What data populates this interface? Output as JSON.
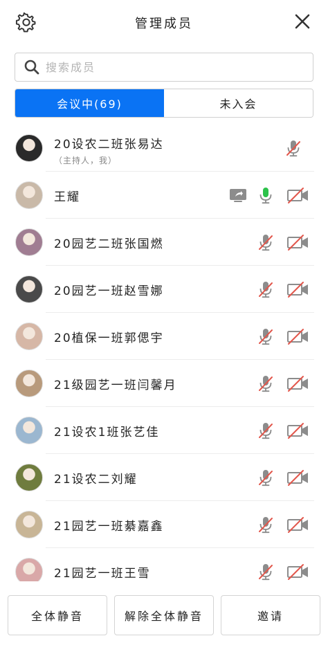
{
  "header": {
    "title": "管理成员"
  },
  "search": {
    "placeholder": "搜索成员"
  },
  "tabs": [
    {
      "label": "会议中(69)",
      "active": true
    },
    {
      "label": "未入会",
      "active": false
    }
  ],
  "members": [
    {
      "name": "20设农二班张易达",
      "subtitle": "（主持人，我）",
      "mic": "host-muted",
      "camera": "none",
      "sharing": false,
      "avatar_color": "#2a2a2a"
    },
    {
      "name": "王耀",
      "subtitle": "",
      "mic": "on",
      "camera": "off",
      "sharing": true,
      "avatar_color": "#c9b9a8"
    },
    {
      "name": "20园艺二班张国燃",
      "subtitle": "",
      "mic": "off",
      "camera": "off",
      "sharing": false,
      "avatar_color": "#a07d92"
    },
    {
      "name": "20园艺一班赵雪娜",
      "subtitle": "",
      "mic": "off",
      "camera": "off",
      "sharing": false,
      "avatar_color": "#4a4a4a"
    },
    {
      "name": "20植保一班郭偲宇",
      "subtitle": "",
      "mic": "off",
      "camera": "off",
      "sharing": false,
      "avatar_color": "#d6b7a6"
    },
    {
      "name": "21级园艺一班闫馨月",
      "subtitle": "",
      "mic": "off",
      "camera": "off",
      "sharing": false,
      "avatar_color": "#b89a7c"
    },
    {
      "name": "21设农1班张艺佳",
      "subtitle": "",
      "mic": "off",
      "camera": "off",
      "sharing": false,
      "avatar_color": "#9bb7d0"
    },
    {
      "name": "21设农二刘耀",
      "subtitle": "",
      "mic": "off",
      "camera": "off",
      "sharing": false,
      "avatar_color": "#6f7c3e"
    },
    {
      "name": "21园艺一班綦嘉鑫",
      "subtitle": "",
      "mic": "off",
      "camera": "off",
      "sharing": false,
      "avatar_color": "#c8b596"
    },
    {
      "name": "21园艺一班王雪",
      "subtitle": "",
      "mic": "off",
      "camera": "off",
      "sharing": false,
      "avatar_color": "#d9a8a8"
    }
  ],
  "footer": {
    "mute_all": "全体静音",
    "unmute_all": "解除全体静音",
    "invite": "邀请"
  },
  "colors": {
    "accent": "#0a73f4",
    "mic_on": "#2cc24a",
    "muted_slash": "#e2574c",
    "icon_gray": "#8c8c8c"
  },
  "icons": [
    "gear-icon",
    "close-icon",
    "search-icon",
    "mic-icon",
    "mic-muted-icon",
    "camera-off-icon",
    "screen-share-icon"
  ]
}
